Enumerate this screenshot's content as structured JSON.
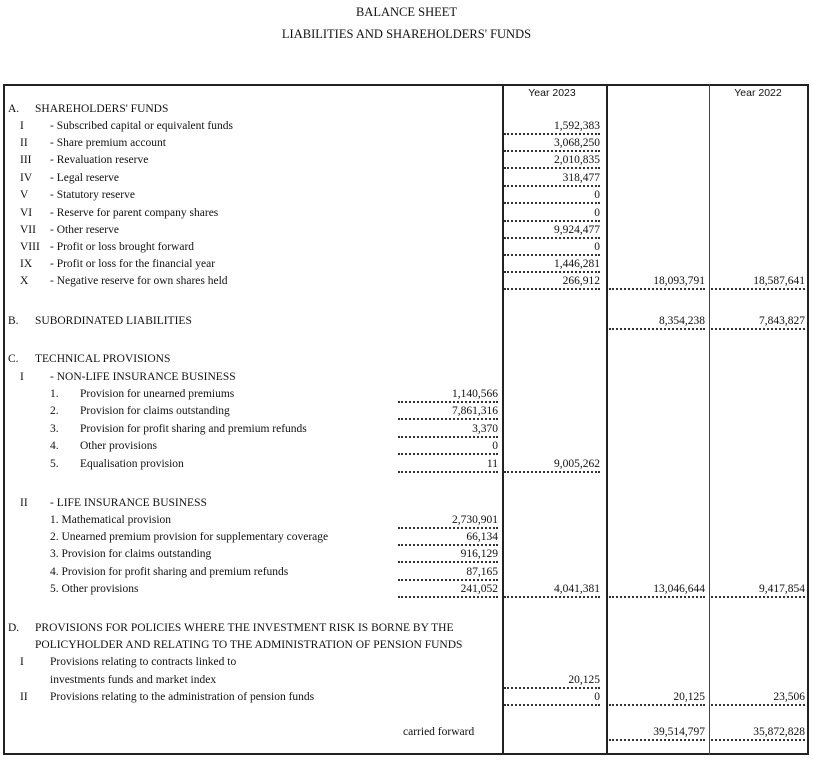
{
  "title": "BALANCE SHEET",
  "subtitle": "LIABILITIES AND SHAREHOLDERS' FUNDS",
  "columns": {
    "year_current": "Year 2023",
    "year_previous": "Year 2022"
  },
  "sectionA": {
    "letter": "A.",
    "heading": "SHAREHOLDERS' FUNDS",
    "items": [
      {
        "num": "I",
        "label": "- Subscribed capital or equivalent funds",
        "value": "1,592,383"
      },
      {
        "num": "II",
        "label": "- Share premium account",
        "value": "3,068,250"
      },
      {
        "num": "III",
        "label": "- Revaluation reserve",
        "value": "2,010,835"
      },
      {
        "num": "IV",
        "label": "- Legal reserve",
        "value": "318,477"
      },
      {
        "num": "V",
        "label": "- Statutory reserve",
        "value": "0"
      },
      {
        "num": "VI",
        "label": "- Reserve for parent company shares",
        "value": "0"
      },
      {
        "num": "VII",
        "label": "- Other reserve",
        "value": "9,924,477"
      },
      {
        "num": "VIII",
        "label": "- Profit or loss brought forward",
        "value": "0"
      },
      {
        "num": "IX",
        "label": "- Profit or loss for the financial year",
        "value": "1,446,281"
      },
      {
        "num": "X",
        "label": "- Negative reserve for own shares held",
        "value": "266,912"
      }
    ],
    "total_2023": "18,093,791",
    "total_2022": "18,587,641"
  },
  "sectionB": {
    "letter": "B.",
    "heading": "SUBORDINATED LIABILITIES",
    "total_2023": "8,354,238",
    "total_2022": "7,843,827"
  },
  "sectionC": {
    "letter": "C.",
    "heading": "TECHNICAL PROVISIONS",
    "nonlife": {
      "num": "I",
      "heading": "- NON-LIFE INSURANCE BUSINESS",
      "items": [
        {
          "num": "1.",
          "label": "Provision for unearned premiums",
          "value": "1,140,566"
        },
        {
          "num": "2.",
          "label": "Provision for claims outstanding",
          "value": "7,861,316"
        },
        {
          "num": "3.",
          "label": "Provision for profit sharing and premium refunds",
          "value": "3,370"
        },
        {
          "num": "4.",
          "label": "Other provisions",
          "value": "0"
        },
        {
          "num": "5.",
          "label": "Equalisation provision",
          "value": "11"
        }
      ],
      "subtotal": "9,005,262"
    },
    "life": {
      "num": "II",
      "heading": "- LIFE INSURANCE BUSINESS",
      "items": [
        {
          "label": "1. Mathematical provision",
          "value": "2,730,901"
        },
        {
          "label": "2. Unearned premium provision for supplementary coverage",
          "value": "66,134"
        },
        {
          "label": "3. Provision for claims outstanding",
          "value": "916,129"
        },
        {
          "label": "4. Provision for profit sharing and premium refunds",
          "value": "87,165"
        },
        {
          "label": "5. Other provisions",
          "value": "241,052"
        }
      ],
      "subtotal": "4,041,381"
    },
    "total_2023": "13,046,644",
    "total_2022": "9,417,854"
  },
  "sectionD": {
    "letter": "D.",
    "heading_line1": "PROVISIONS FOR POLICIES WHERE THE INVESTMENT RISK IS BORNE BY THE",
    "heading_line2": "POLICYHOLDER AND RELATING TO THE ADMINISTRATION OF PENSION FUNDS",
    "items": [
      {
        "num": "I",
        "label_line1": "Provisions relating to contracts linked to",
        "label_line2": "investments funds and market index",
        "value": "20,125"
      },
      {
        "num": "II",
        "label_line1": "Provisions relating to the administration of pension funds",
        "value": "0"
      }
    ],
    "total_2023": "20,125",
    "total_2022": "23,506"
  },
  "carried_forward": {
    "label": "carried forward",
    "total_2023": "39,514,797",
    "total_2022": "35,872,828"
  }
}
